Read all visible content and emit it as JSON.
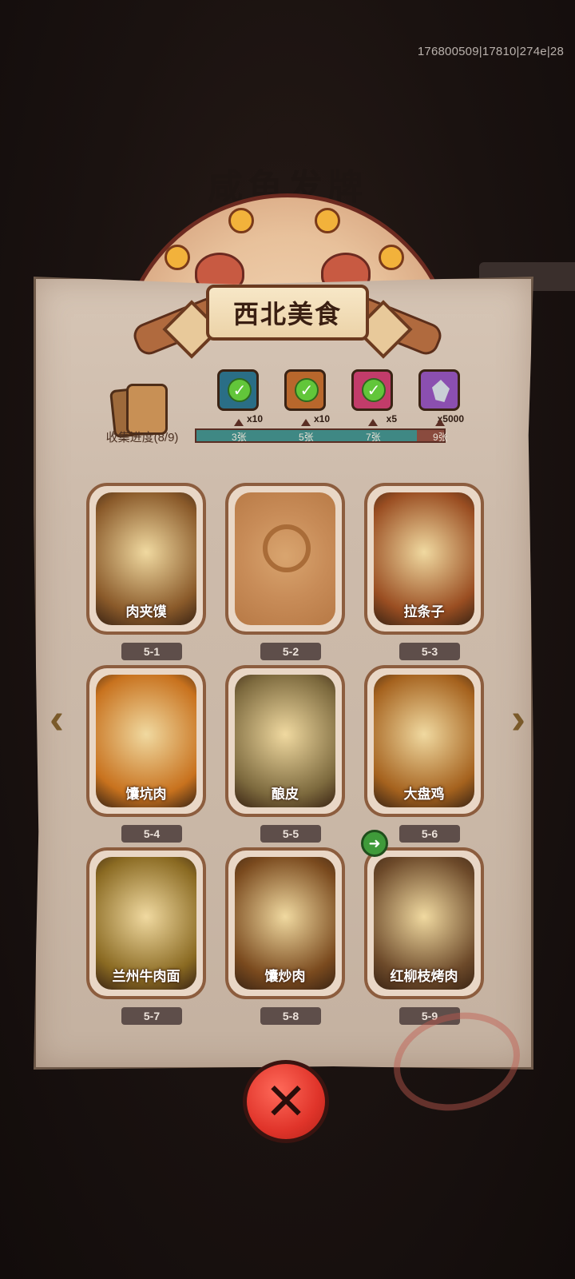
{
  "debug_info": "176800509|17810|274e|28",
  "background_title": "咸鱼发牌",
  "title": "西北美食",
  "progress": {
    "label": "收集进度(8/9)",
    "collected": 8,
    "total": 9,
    "milestones": [
      {
        "label": "3张",
        "reward_icon": "treasure-chest-icon",
        "qty": "x10",
        "claimed": true,
        "color": "#2a6e86"
      },
      {
        "label": "5张",
        "reward_icon": "hammer-icon",
        "qty": "x10",
        "claimed": true,
        "color": "#b8672c"
      },
      {
        "label": "7张",
        "reward_icon": "orb-icon",
        "qty": "x5",
        "claimed": true,
        "color": "#c23c6a"
      },
      {
        "label": "9张",
        "reward_icon": "crystal-icon",
        "qty": "x5000",
        "claimed": false,
        "color": "#8b4fb0"
      }
    ]
  },
  "cards": [
    {
      "id": "5-1",
      "name": "肉夹馍",
      "locked": false,
      "tone": "#8a5a2a"
    },
    {
      "id": "5-2",
      "name": "",
      "locked": true,
      "tone": "#c88c58"
    },
    {
      "id": "5-3",
      "name": "拉条子",
      "locked": false,
      "tone": "#9a4e22"
    },
    {
      "id": "5-4",
      "name": "馕坑肉",
      "locked": false,
      "tone": "#c8721e"
    },
    {
      "id": "5-5",
      "name": "酿皮",
      "locked": false,
      "tone": "#7d6a3e"
    },
    {
      "id": "5-6",
      "name": "大盘鸡",
      "locked": false,
      "tone": "#a5621e"
    },
    {
      "id": "5-7",
      "name": "兰州牛肉面",
      "locked": false,
      "tone": "#8a6a22"
    },
    {
      "id": "5-8",
      "name": "馕炒肉",
      "locked": false,
      "tone": "#7a4a1e"
    },
    {
      "id": "5-9",
      "name": "红柳枝烤肉",
      "locked": false,
      "tone": "#6d4a2a"
    }
  ],
  "nav": {
    "prev_icon": "chevron-left-icon",
    "next_icon": "chevron-right-icon"
  },
  "close_icon": "close-icon",
  "share_icon": "share-arrow-icon",
  "colors": {
    "progress_fill": "#3f8884",
    "progress_empty": "#8a4b3e",
    "close_button": "#e0342a"
  }
}
